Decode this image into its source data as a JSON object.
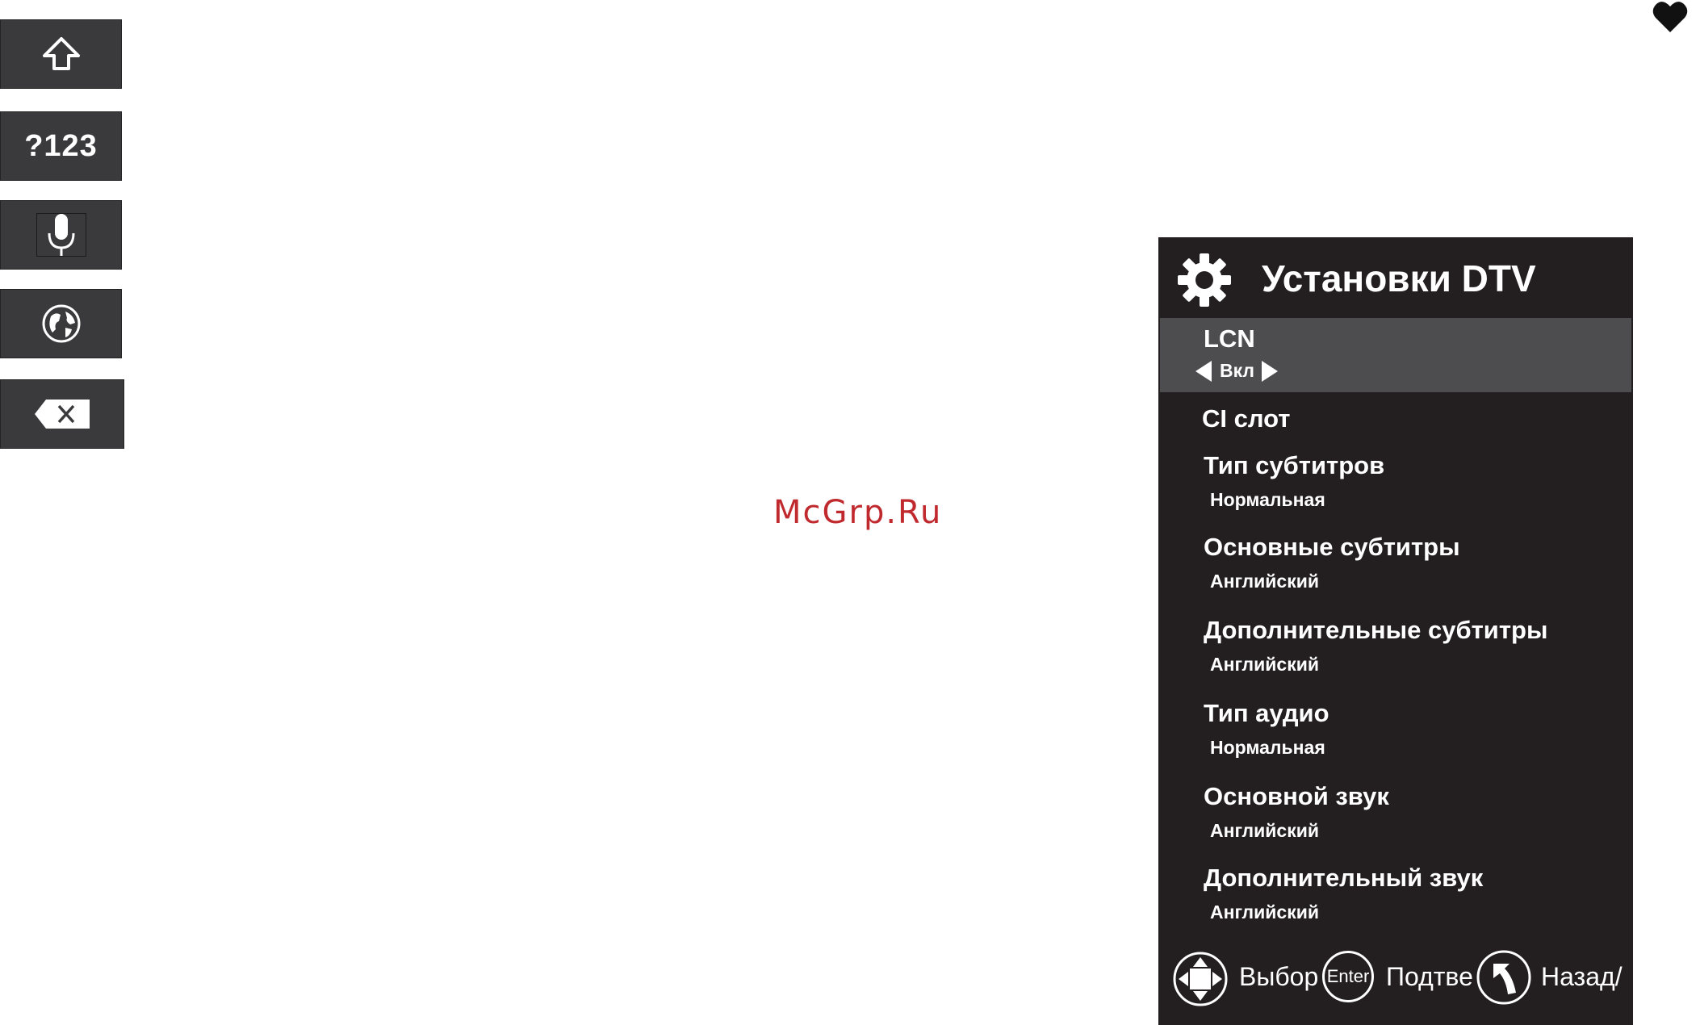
{
  "keyboard": {
    "shift_icon": "shift-arrow-icon",
    "symbols_label": "?123",
    "mic_icon": "microphone-icon",
    "globe_icon": "globe-icon",
    "backspace_icon": "backspace-icon"
  },
  "watermark": "McGrp.Ru",
  "heart_icon": "heart-icon",
  "menu": {
    "title": "Установки DTV",
    "icon": "gear-icon",
    "items": [
      {
        "label": "LCN",
        "value": "Вкл",
        "selected": true
      },
      {
        "label": "CI слот",
        "value": ""
      },
      {
        "label": "Тип субтитров",
        "value": "Нормальная"
      },
      {
        "label": "Основные субтитры",
        "value": "Английский"
      },
      {
        "label": "Дополнительные субтитры",
        "value": "Английский"
      },
      {
        "label": "Тип аудио",
        "value": "Нормальная"
      },
      {
        "label": "Основной звук",
        "value": "Английский"
      },
      {
        "label": "Дополнительный звук",
        "value": "Английский"
      }
    ],
    "footer": {
      "select_icon": "dpad-icon",
      "select_label": "Выбор",
      "enter_icon": "enter-button-icon",
      "enter_text": "Enter",
      "confirm_label": "Подтве",
      "back_icon": "back-arrow-icon",
      "back_label": "Назад/"
    }
  },
  "colors": {
    "panel_bg": "#231f20",
    "highlight_bg": "#4d4d4f",
    "button_bg": "#3a3a3c",
    "watermark": "#c0292d"
  }
}
